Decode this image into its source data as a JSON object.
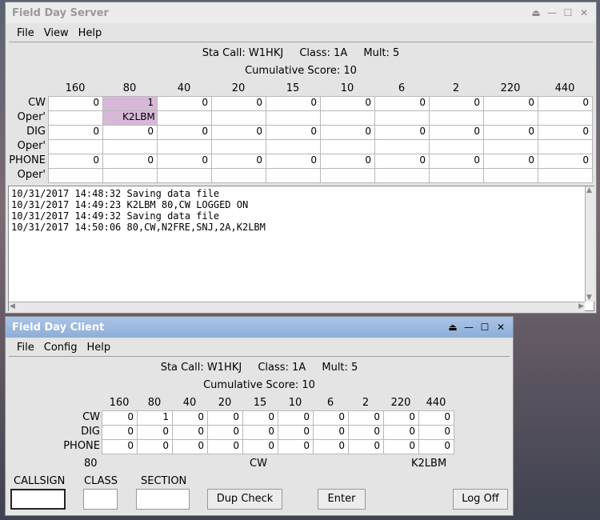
{
  "server": {
    "title": "Field Day Server",
    "menu": [
      "File",
      "View",
      "Help"
    ],
    "sta_call": "Sta Call: W1HKJ",
    "class": "Class: 1A",
    "mult": "Mult: 5",
    "score": "Cumulative Score: 10",
    "bands": [
      "160",
      "80",
      "40",
      "20",
      "15",
      "10",
      "6",
      "2",
      "220",
      "440"
    ],
    "rows": [
      {
        "label": "CW",
        "values": [
          "0",
          "1",
          "0",
          "0",
          "0",
          "0",
          "0",
          "0",
          "0",
          "0"
        ]
      },
      {
        "label": "Oper'",
        "values": [
          "",
          "K2LBM",
          "",
          "",
          "",
          "",
          "",
          "",
          "",
          ""
        ]
      },
      {
        "label": "DIG",
        "values": [
          "0",
          "0",
          "0",
          "0",
          "0",
          "0",
          "0",
          "0",
          "0",
          "0"
        ]
      },
      {
        "label": "Oper'",
        "values": [
          "",
          "",
          "",
          "",
          "",
          "",
          "",
          "",
          "",
          ""
        ]
      },
      {
        "label": "PHONE",
        "values": [
          "0",
          "0",
          "0",
          "0",
          "0",
          "0",
          "0",
          "0",
          "0",
          "0"
        ]
      },
      {
        "label": "Oper'",
        "values": [
          "",
          "",
          "",
          "",
          "",
          "",
          "",
          "",
          "",
          ""
        ]
      }
    ],
    "log": [
      "10/31/2017 14:48:32 Saving data file",
      "10/31/2017 14:49:23 K2LBM 80,CW LOGGED ON",
      "10/31/2017 14:49:32 Saving data file",
      "10/31/2017 14:50:06 80,CW,N2FRE,SNJ,2A,K2LBM"
    ]
  },
  "client": {
    "title": "Field Day Client",
    "menu": [
      "File",
      "Config",
      "Help"
    ],
    "sta_call": "Sta Call: W1HKJ",
    "class": "Class: 1A",
    "mult": "Mult: 5",
    "score": "Cumulative Score: 10",
    "bands": [
      "160",
      "80",
      "40",
      "20",
      "15",
      "10",
      "6",
      "2",
      "220",
      "440"
    ],
    "rows": [
      {
        "label": "CW",
        "values": [
          "0",
          "1",
          "0",
          "0",
          "0",
          "0",
          "0",
          "0",
          "0",
          "0"
        ]
      },
      {
        "label": "DIG",
        "values": [
          "0",
          "0",
          "0",
          "0",
          "0",
          "0",
          "0",
          "0",
          "0",
          "0"
        ]
      },
      {
        "label": "PHONE",
        "values": [
          "0",
          "0",
          "0",
          "0",
          "0",
          "0",
          "0",
          "0",
          "0",
          "0"
        ]
      }
    ],
    "status_band": "80",
    "status_mode": "CW",
    "status_oper": "K2LBM",
    "callsign_label": "CALLSIGN",
    "class_label": "CLASS",
    "section_label": "SECTION",
    "callsign_value": "",
    "class_value": "",
    "section_value": "",
    "dup_check": "Dup Check",
    "enter": "Enter",
    "log_off": "Log Off"
  }
}
